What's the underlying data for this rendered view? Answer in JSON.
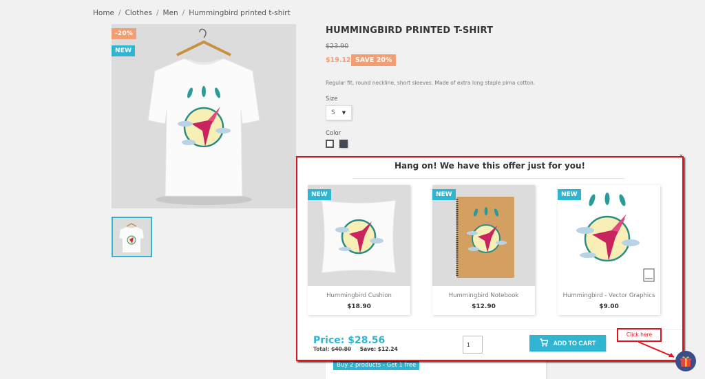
{
  "breadcrumb": [
    {
      "label": "Home"
    },
    {
      "label": "Clothes"
    },
    {
      "label": "Men"
    },
    {
      "label": "Hummingbird printed t-shirt"
    }
  ],
  "breadcrumb_separator": "/",
  "product": {
    "title": "HUMMINGBIRD PRINTED T-SHIRT",
    "old_price": "$23.90",
    "price": "$19.12",
    "save_badge": "SAVE 20%",
    "description": "Regular fit, round neckline, short sleeves. Made of extra long staple pima cotton.",
    "discount_flag": "-20%",
    "new_flag": "NEW",
    "image_alt": "t-shirt-product-image",
    "size_label": "Size",
    "size_value": "S",
    "color_label": "Color",
    "colors": [
      {
        "name": "White",
        "hex": "#ffffff",
        "selected": true
      },
      {
        "name": "Black",
        "hex": "#434a54",
        "selected": false
      }
    ],
    "promo_tag": "Buy 2 products - Get 1 free"
  },
  "offer_modal": {
    "close_label": "x",
    "title": "Hang on! We have this offer just for you!",
    "products": [
      {
        "name": "Hummingbird Cushion",
        "price": "$18.90",
        "flag": "NEW",
        "image": "cushion"
      },
      {
        "name": "Hummingbird Notebook",
        "price": "$12.90",
        "flag": "NEW",
        "image": "notebook"
      },
      {
        "name": "Hummingbird - Vector Graphics",
        "price": "$9.00",
        "flag": "NEW",
        "image": "vector"
      }
    ],
    "price_label": "Price: $28.56",
    "total_label": "Total:",
    "total_value": "$40.80",
    "save_label": "Save: $12.24",
    "quantity": "1",
    "add_to_cart_label": "ADD TO CART",
    "add_to_cart_icon": "cart-icon"
  },
  "annotation": {
    "label": "Click here"
  },
  "gift_button": {
    "icon": "gift-icon"
  },
  "colors": {
    "accent": "#2fb5d2",
    "discount": "#f39d72",
    "annotation_red": "#e0141e",
    "gift_bg": "#3a4e87"
  }
}
